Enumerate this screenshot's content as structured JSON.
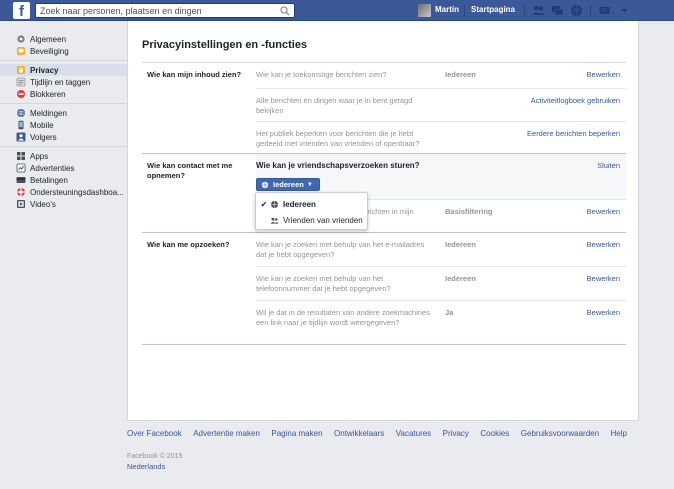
{
  "topbar": {
    "logo": "f",
    "search_placeholder": "Zoek naar personen, plaatsen en dingen",
    "user_name": "Martin",
    "home_label": "Startpagina"
  },
  "sidebar": {
    "groups": [
      [
        {
          "label": "Algemeen",
          "icon": "gear-icon"
        },
        {
          "label": "Beveiliging",
          "icon": "shield-icon"
        }
      ],
      [
        {
          "label": "Privacy",
          "icon": "lock-icon",
          "active": true
        },
        {
          "label": "Tijdlijn en taggen",
          "icon": "timeline-icon"
        },
        {
          "label": "Blokkeren",
          "icon": "block-icon"
        }
      ],
      [
        {
          "label": "Meldingen",
          "icon": "globe-icon"
        },
        {
          "label": "Mobile",
          "icon": "mobile-icon"
        },
        {
          "label": "Volgers",
          "icon": "followers-icon"
        }
      ],
      [
        {
          "label": "Apps",
          "icon": "apps-icon"
        },
        {
          "label": "Advertenties",
          "icon": "ads-icon"
        },
        {
          "label": "Betalingen",
          "icon": "payments-icon"
        },
        {
          "label": "Ondersteuningsdashboa...",
          "icon": "support-icon"
        },
        {
          "label": "Video's",
          "icon": "video-icon"
        }
      ]
    ]
  },
  "main": {
    "title": "Privacyinstellingen en -functies",
    "sections": [
      {
        "heading": "Wie kan mijn inhoud zien?",
        "rows": [
          {
            "question": "Wie kan je toekomstige berichten zien?",
            "value": "Iedereen",
            "action": "Bewerken"
          },
          {
            "question": "Alle berichten en dingen waar je in bent getagd bekijken",
            "value": "",
            "action": "Activiteitlogboek gebruiken"
          },
          {
            "question": "Het publiek beperken voor berichten die je hebt gedeeld met vrienden van vrienden of openbaar?",
            "value": "",
            "action": "Eerdere berichten beperken"
          }
        ]
      },
      {
        "heading": "Wie kan contact met me opnemen?",
        "open_question": "Wie kan je vriendschapsverzoeken sturen?",
        "close_label": "Sluiten",
        "audience_button": "Iedereen",
        "rows": [
          {
            "question": "berichten in mijn",
            "value": "Basisfiltering",
            "action": "Bewerken"
          }
        ]
      },
      {
        "heading": "Wie kan me opzoeken?",
        "rows": [
          {
            "question": "Wie kan je zoeken met behulp van het e-mailadres dat je hebt opgegeven?",
            "value": "Iedereen",
            "action": "Bewerken"
          },
          {
            "question": "Wie kan je zoeken met behulp van het telefoonnummer dat je hebt opgegeven?",
            "value": "Iedereen",
            "action": "Bewerken"
          },
          {
            "question": "Wil je dat in de resultaten van andere zoekmachines een link naar je tijdlijn wordt weergegeven?",
            "value": "Ja",
            "action": "Bewerken"
          }
        ]
      }
    ],
    "dropdown": {
      "options": [
        {
          "label": "Iedereen",
          "checked": true,
          "icon": "globe-icon"
        },
        {
          "label": "Vrienden van vrienden",
          "checked": false,
          "icon": "friends-icon"
        }
      ]
    }
  },
  "footer": {
    "links": [
      "Over Facebook",
      "Advertentie maken",
      "Pagina maken",
      "Ontwikkelaars",
      "Vacatures",
      "Privacy",
      "Cookies",
      "Gebruiksvoorwaarden",
      "Help"
    ],
    "copyright": "Facebook © 2015",
    "language": "Nederlands"
  },
  "colors": {
    "brand": "#3b5998",
    "link": "#365899",
    "button": "#4267b2"
  }
}
